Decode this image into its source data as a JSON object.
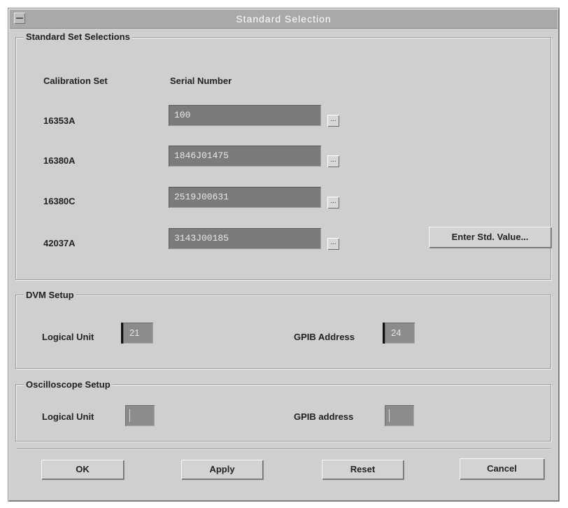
{
  "window": {
    "title": "Standard Selection"
  },
  "standard_set": {
    "group_label": "Standard Set Selections",
    "col_calibration": "Calibration Set",
    "col_serial": "Serial Number",
    "rows": [
      {
        "set": "16353A",
        "serial": "100",
        "browse": "..."
      },
      {
        "set": "16380A",
        "serial": "1846J01475",
        "browse": "..."
      },
      {
        "set": "16380C",
        "serial": "2519J00631",
        "browse": "..."
      },
      {
        "set": "42037A",
        "serial": "3143J00185",
        "browse": "..."
      }
    ],
    "enter_std_value": "Enter Std. Value..."
  },
  "dvm": {
    "group_label": "DVM Setup",
    "logical_unit_label": "Logical Unit",
    "logical_unit_value": "21",
    "gpib_label": "GPIB Address",
    "gpib_value": "24"
  },
  "oscilloscope": {
    "group_label": "Oscilloscope Setup",
    "logical_unit_label": "Logical Unit",
    "logical_unit_value": "",
    "gpib_label": "GPIB address",
    "gpib_value": ""
  },
  "buttons": {
    "ok": "OK",
    "apply": "Apply",
    "reset": "Reset",
    "cancel": "Cancel"
  }
}
